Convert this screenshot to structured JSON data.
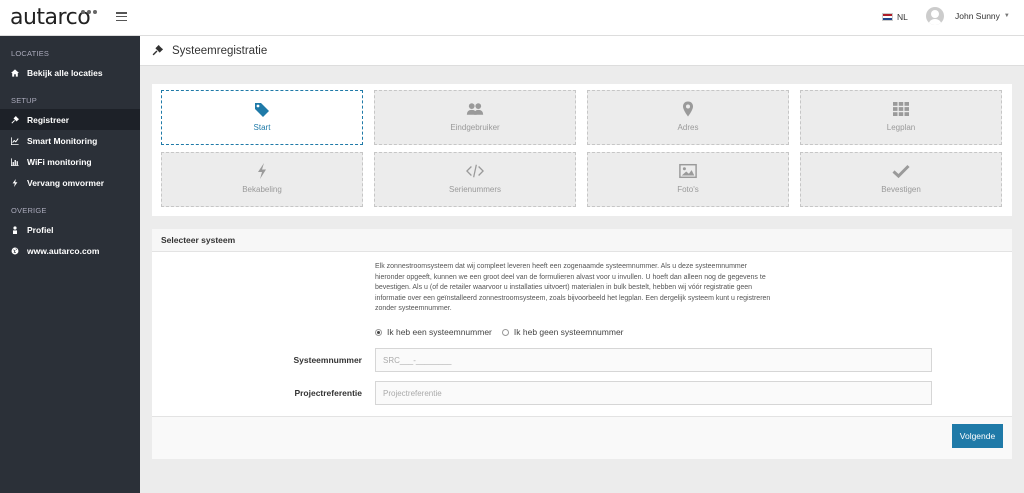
{
  "topbar": {
    "logo": "autarco",
    "language": "NL",
    "user_name": "John Sunny",
    "colors": {
      "flag": [
        "#ae1c28",
        "#ffffff",
        "#21468b"
      ]
    }
  },
  "sidebar": {
    "sections": [
      {
        "heading": "LOCATIES",
        "items": [
          {
            "label": "Bekijk alle locaties",
            "icon": "home-icon"
          }
        ]
      },
      {
        "heading": "SETUP",
        "items": [
          {
            "label": "Registreer",
            "icon": "plug-icon"
          },
          {
            "label": "Smart Monitoring",
            "icon": "line-chart-icon"
          },
          {
            "label": "WiFi monitoring",
            "icon": "bar-chart-icon"
          },
          {
            "label": "Vervang omvormer",
            "icon": "bolt-icon"
          }
        ]
      },
      {
        "heading": "OVERIGE",
        "items": [
          {
            "label": "Profiel",
            "icon": "user-icon"
          },
          {
            "label": "www.autarco.com",
            "icon": "globe-icon"
          }
        ]
      }
    ]
  },
  "page": {
    "title": "Systeemregistratie",
    "icon": "plug-icon"
  },
  "steps": [
    {
      "label": "Start",
      "icon": "tag-icon"
    },
    {
      "label": "Eindgebruiker",
      "icon": "users-icon"
    },
    {
      "label": "Adres",
      "icon": "map-marker-icon"
    },
    {
      "label": "Legplan",
      "icon": "grid-icon"
    },
    {
      "label": "Bekabeling",
      "icon": "bolt-icon"
    },
    {
      "label": "Serienummers",
      "icon": "code-icon"
    },
    {
      "label": "Foto's",
      "icon": "picture-icon"
    },
    {
      "label": "Bevestigen",
      "icon": "check-icon"
    }
  ],
  "form": {
    "section_title": "Selecteer systeem",
    "intro": "Elk zonnestroomsysteem dat wij compleet leveren heeft een zogenaamde systeemnummer. Als u deze systeemnummer hieronder opgeeft, kunnen we een groot deel van de formulieren alvast voor u invullen. U hoeft dan alleen nog de gegevens te bevestigen. Als u (of de retailer waarvoor u installaties uitvoert) materialen in bulk bestelt, hebben wij vóór registratie geen informatie over een geïnstalleerd zonnestroomsysteem, zoals bijvoorbeeld het legplan. Een dergelijk systeem kunt u registreren zonder systeemnummer.",
    "radio_yes": "Ik heb een systeemnummer",
    "radio_no": "Ik heb geen systeemnummer",
    "systeemnummer_label": "Systeemnummer",
    "systeemnummer_placeholder": "SRC___-________",
    "projectreferentie_label": "Projectreferentie",
    "projectreferentie_placeholder": "Projectreferentie",
    "next_button": "Volgende"
  },
  "colors": {
    "accent": "#1f7aa8",
    "sidebar": "#2b3038"
  }
}
